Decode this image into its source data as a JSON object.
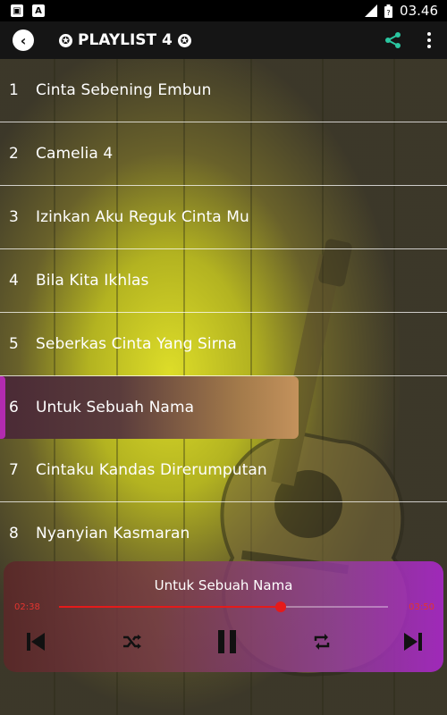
{
  "status_bar": {
    "time": "03.46",
    "left_icons": [
      "image-icon",
      "a-icon"
    ]
  },
  "toolbar": {
    "title": "PLAYLIST 4",
    "star_glyph": "✪"
  },
  "tracks": [
    {
      "number": "1",
      "title": "Cinta Sebening Embun"
    },
    {
      "number": "2",
      "title": "Camelia 4"
    },
    {
      "number": "3",
      "title": "Izinkan Aku Reguk Cinta Mu"
    },
    {
      "number": "4",
      "title": "Bila Kita Ikhlas"
    },
    {
      "number": "5",
      "title": "Seberkas Cinta Yang Sirna"
    },
    {
      "number": "6",
      "title": "Untuk Sebuah Nama",
      "active": true
    },
    {
      "number": "7",
      "title": "Cintaku Kandas Direrumputan"
    },
    {
      "number": "8",
      "title": "Nyanyian Kasmaran"
    }
  ],
  "player": {
    "now_playing": "Untuk Sebuah Nama",
    "current_time": "02:38",
    "duration": "03:50",
    "progress": 0.675,
    "controls": [
      "previous-icon",
      "shuffle-icon",
      "pause-icon",
      "repeat-icon",
      "next-icon"
    ]
  },
  "colors": {
    "accent": "#e51a1a",
    "share": "#2bc6a0",
    "active_marker": "#b22bb0"
  }
}
